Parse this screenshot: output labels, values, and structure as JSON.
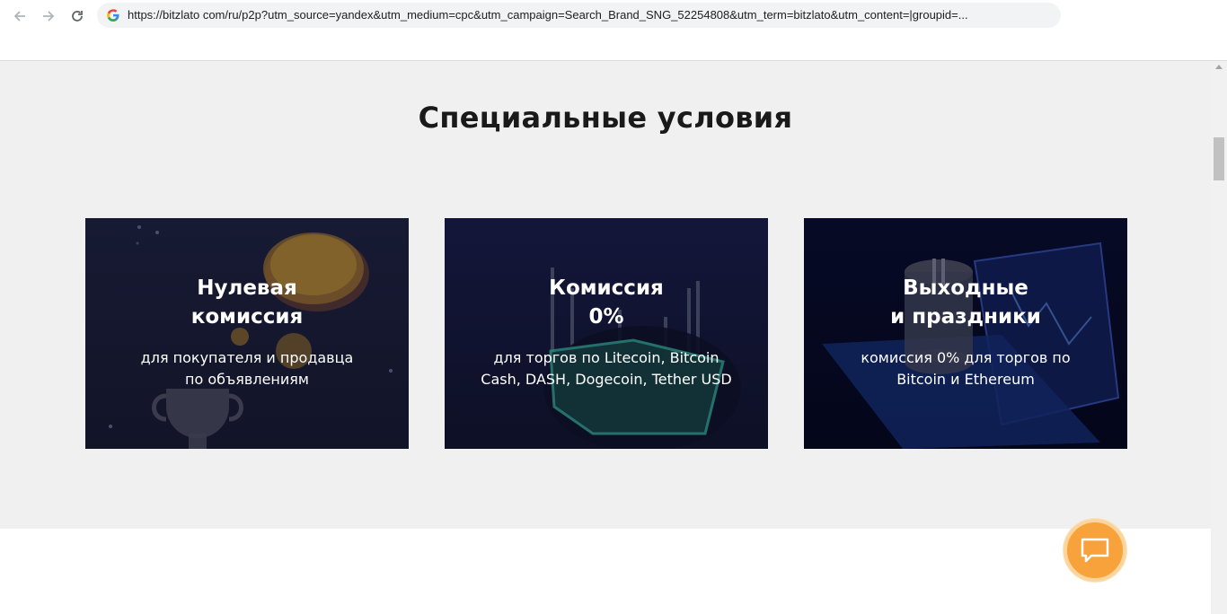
{
  "browser": {
    "url": "https://bitzlato com/ru/p2p?utm_source=yandex&utm_medium=cpc&utm_campaign=Search_Brand_SNG_52254808&utm_term=bitzlato&utm_content=|groupid=..."
  },
  "section": {
    "title": "Специальные условия",
    "cards": [
      {
        "title_line1": "Нулевая",
        "title_line2": "комиссия",
        "desc_line1": "для покупателя и продавца",
        "desc_line2": "по объявлениям"
      },
      {
        "title_line1": "Комиссия",
        "title_line2": "0%",
        "desc_line1": "для торгов по Litecoin, Bitcoin",
        "desc_line2": "Cash, DASH, Dogecoin, Tether USD"
      },
      {
        "title_line1": "Выходные",
        "title_line2": "и праздники",
        "desc_line1": "комиссия 0% для торгов по",
        "desc_line2": "Bitcoin и Ethereum"
      }
    ]
  },
  "colors": {
    "section_bg": "#f0f0f0",
    "card_bg_dark": "#121428",
    "chat_button": "#f7a23b"
  },
  "icons": {
    "back": "arrow-left-icon",
    "forward": "arrow-right-icon",
    "reload": "reload-icon",
    "site": "google-icon",
    "chat": "chat-bubble-icon"
  }
}
